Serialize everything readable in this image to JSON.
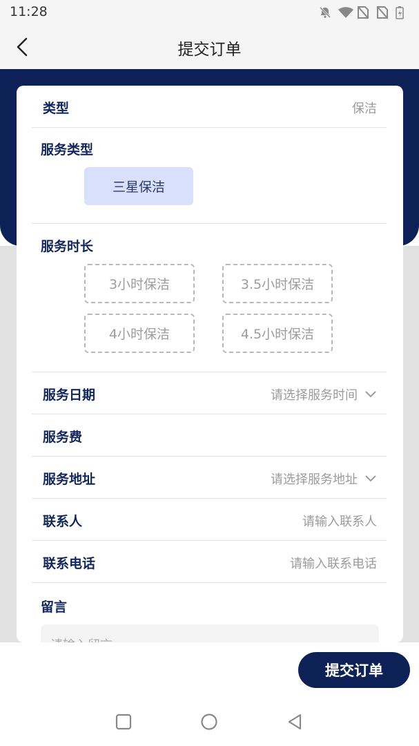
{
  "status_bar": {
    "time": "11:28"
  },
  "header": {
    "title": "提交订单"
  },
  "form": {
    "type_label": "类型",
    "type_value": "保洁",
    "service_type_label": "服务类型",
    "service_type_option": "三星保洁",
    "duration_label": "服务时长",
    "duration_options": [
      "3小时保洁",
      "3.5小时保洁",
      "4小时保洁",
      "4.5小时保洁"
    ],
    "date_label": "服务日期",
    "date_placeholder": "请选择服务时间",
    "fee_label": "服务费",
    "address_label": "服务地址",
    "address_placeholder": "请选择服务地址",
    "contact_label": "联系人",
    "contact_placeholder": "请输入联系人",
    "phone_label": "联系电话",
    "phone_placeholder": "请输入联系电话",
    "message_label": "留言",
    "message_placeholder": "请输入留言"
  },
  "footer": {
    "submit_label": "提交订单"
  },
  "colors": {
    "primary": "#0e2156",
    "chip_selected": "#d8e0fb"
  }
}
